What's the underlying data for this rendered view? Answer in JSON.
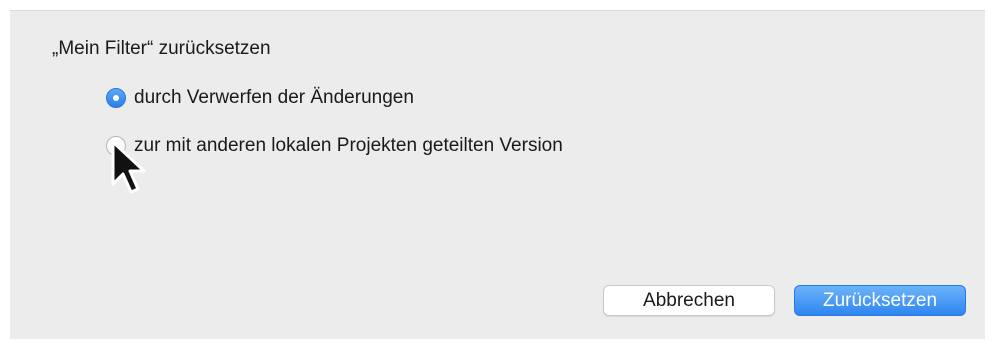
{
  "dialog": {
    "title": "„Mein Filter“ zurücksetzen",
    "options": [
      {
        "label": "durch Verwerfen der Änderungen",
        "selected": true
      },
      {
        "label": "zur mit anderen lokalen Projekten geteilten Version",
        "selected": false
      }
    ],
    "buttons": {
      "cancel_label": "Abbrechen",
      "reset_label": "Zurücksetzen"
    }
  },
  "colors": {
    "accent": "#2d86f0",
    "background": "#ececec"
  },
  "icons": {
    "cursor": "arrow-cursor-icon"
  }
}
